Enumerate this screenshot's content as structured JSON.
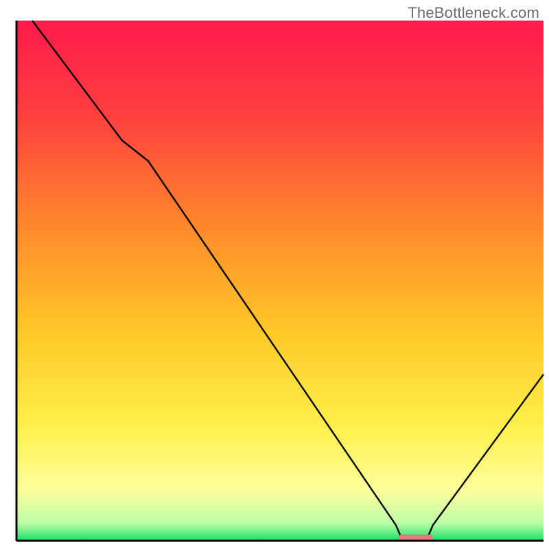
{
  "watermark": "TheBottleneck.com",
  "chart_data": {
    "type": "line",
    "title": "",
    "xlabel": "",
    "ylabel": "",
    "xlim": [
      0,
      100
    ],
    "ylim": [
      0,
      100
    ],
    "grid": false,
    "legend": false,
    "watermark_text": "TheBottleneck.com",
    "gradient_stops": [
      {
        "offset": 0.0,
        "color": "#ff1a4b"
      },
      {
        "offset": 0.18,
        "color": "#ff3f3f"
      },
      {
        "offset": 0.4,
        "color": "#ff8a2a"
      },
      {
        "offset": 0.6,
        "color": "#ffc928"
      },
      {
        "offset": 0.78,
        "color": "#fff04a"
      },
      {
        "offset": 0.9,
        "color": "#fdff9a"
      },
      {
        "offset": 0.965,
        "color": "#bfffa8"
      },
      {
        "offset": 1.0,
        "color": "#1adf68"
      }
    ],
    "curve": {
      "description": "Bottleneck-style V-curve. Value=100 means maximal bottleneck (top), 0 means none (bottom). Minimum around x≈75.",
      "points": [
        {
          "x": 3,
          "y": 100
        },
        {
          "x": 20,
          "y": 77
        },
        {
          "x": 25,
          "y": 73
        },
        {
          "x": 72,
          "y": 3
        },
        {
          "x": 73,
          "y": 0.6
        },
        {
          "x": 78,
          "y": 0.6
        },
        {
          "x": 79,
          "y": 3
        },
        {
          "x": 100,
          "y": 32
        }
      ]
    },
    "marker": {
      "description": "Flat segment at bottom near minimum, salmon-colored rounded bar.",
      "x_start": 72.5,
      "x_end": 79,
      "y": 0.6,
      "color": "#e47a7a"
    },
    "axes": {
      "color": "#000000",
      "left": true,
      "bottom": true,
      "top": false,
      "right": false
    }
  }
}
